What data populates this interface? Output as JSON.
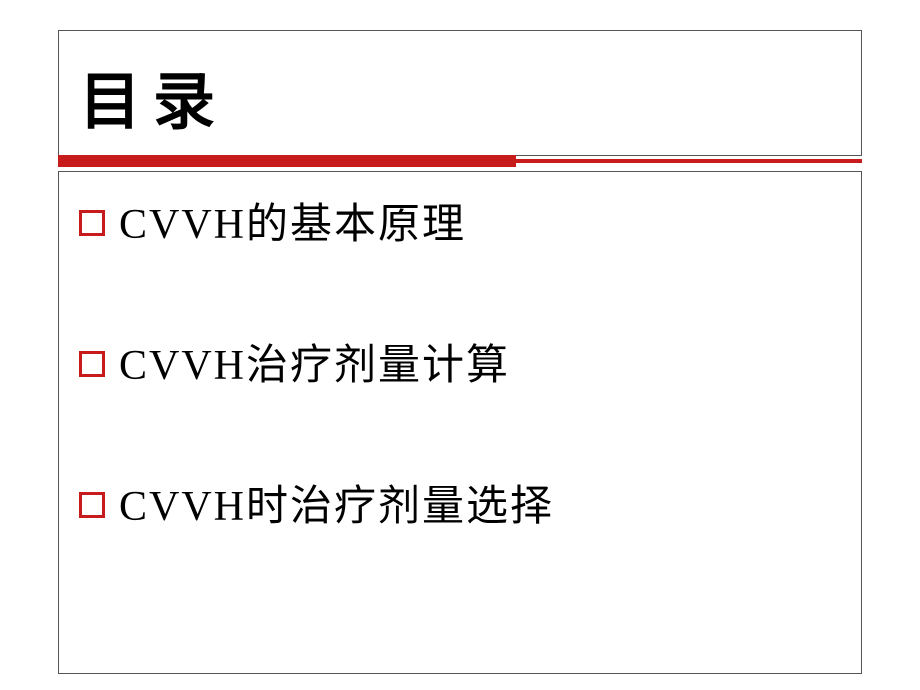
{
  "title": "目录",
  "items": [
    {
      "text": "CVVH的基本原理"
    },
    {
      "text": "CVVH治疗剂量计算"
    },
    {
      "text": "CVVH时治疗剂量选择"
    }
  ],
  "colors": {
    "accent": "#c81c1c",
    "border": "#555555"
  }
}
